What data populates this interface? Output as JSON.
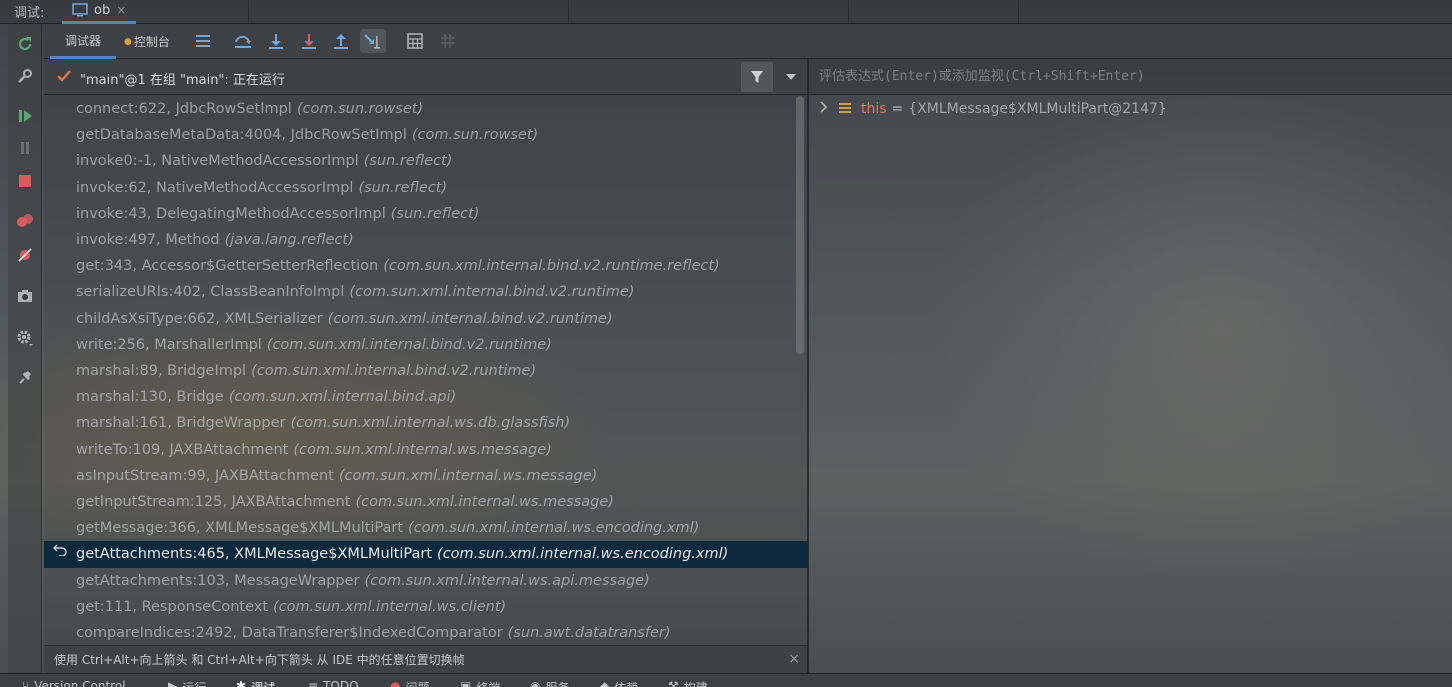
{
  "topbar": {
    "label": "调试:",
    "run_tab": {
      "name": "ob",
      "close": "×"
    }
  },
  "left_toolbar": {
    "icons": [
      "rerun-icon",
      "wrench-icon",
      "resume-icon",
      "pause-icon",
      "stop-icon",
      "breakpoints-icon",
      "mute-breakpoints-icon",
      "camera-icon",
      "settings-icon",
      "pin-icon"
    ]
  },
  "toolbar": {
    "tabs": [
      {
        "label": "调试器",
        "active": true
      },
      {
        "label": "控制台",
        "active": false
      }
    ],
    "buttons": [
      "frames-list-icon",
      "step-over-icon",
      "step-into-icon",
      "force-step-into-icon",
      "step-out-icon",
      "run-to-cursor-icon",
      "evaluate-expression-icon",
      "trace-icon"
    ]
  },
  "frames_panel": {
    "thread_label": "\"main\"@1 在组 \"main\": 正在运行",
    "frames": [
      {
        "method": "connect:622, JdbcRowSetImpl",
        "pkg": "(com.sun.rowset)"
      },
      {
        "method": "getDatabaseMetaData:4004, JdbcRowSetImpl",
        "pkg": "(com.sun.rowset)"
      },
      {
        "method": "invoke0:-1, NativeMethodAccessorImpl",
        "pkg": "(sun.reflect)"
      },
      {
        "method": "invoke:62, NativeMethodAccessorImpl",
        "pkg": "(sun.reflect)"
      },
      {
        "method": "invoke:43, DelegatingMethodAccessorImpl",
        "pkg": "(sun.reflect)"
      },
      {
        "method": "invoke:497, Method",
        "pkg": "(java.lang.reflect)"
      },
      {
        "method": "get:343, Accessor$GetterSetterReflection",
        "pkg": "(com.sun.xml.internal.bind.v2.runtime.reflect)"
      },
      {
        "method": "serializeURIs:402, ClassBeanInfoImpl",
        "pkg": "(com.sun.xml.internal.bind.v2.runtime)"
      },
      {
        "method": "childAsXsiType:662, XMLSerializer",
        "pkg": "(com.sun.xml.internal.bind.v2.runtime)"
      },
      {
        "method": "write:256, MarshallerImpl",
        "pkg": "(com.sun.xml.internal.bind.v2.runtime)"
      },
      {
        "method": "marshal:89, BridgeImpl",
        "pkg": "(com.sun.xml.internal.bind.v2.runtime)"
      },
      {
        "method": "marshal:130, Bridge",
        "pkg": "(com.sun.xml.internal.bind.api)"
      },
      {
        "method": "marshal:161, BridgeWrapper",
        "pkg": "(com.sun.xml.internal.ws.db.glassfish)"
      },
      {
        "method": "writeTo:109, JAXBAttachment",
        "pkg": "(com.sun.xml.internal.ws.message)"
      },
      {
        "method": "asInputStream:99, JAXBAttachment",
        "pkg": "(com.sun.xml.internal.ws.message)"
      },
      {
        "method": "getInputStream:125, JAXBAttachment",
        "pkg": "(com.sun.xml.internal.ws.message)"
      },
      {
        "method": "getMessage:366, XMLMessage$XMLMultiPart",
        "pkg": "(com.sun.xml.internal.ws.encoding.xml)"
      },
      {
        "method": "getAttachments:465, XMLMessage$XMLMultiPart",
        "pkg": "(com.sun.xml.internal.ws.encoding.xml)",
        "current": true
      },
      {
        "method": "getAttachments:103, MessageWrapper",
        "pkg": "(com.sun.xml.internal.ws.api.message)"
      },
      {
        "method": "get:111, ResponseContext",
        "pkg": "(com.sun.xml.internal.ws.client)"
      },
      {
        "method": "compareIndices:2492, DataTransferer$IndexedComparator",
        "pkg": "(sun.awt.datatransfer)"
      }
    ],
    "hint": "使用 Ctrl+Alt+向上箭头 和 Ctrl+Alt+向下箭头 从 IDE 中的任意位置切换帧",
    "hint_close": "×"
  },
  "variables_panel": {
    "eval_placeholder": "评估表达式(Enter)或添加监视(Ctrl+Shift+Enter)",
    "variables": [
      {
        "name": "this",
        "value": "{XMLMessage$XMLMultiPart@2147}"
      }
    ]
  },
  "bottom_bar": {
    "items": [
      {
        "label": "Version Control"
      },
      {
        "label": "运行"
      },
      {
        "label": "调试",
        "active": true
      },
      {
        "label": "TODO"
      },
      {
        "label": "问题"
      },
      {
        "label": "终端"
      },
      {
        "label": "服务"
      },
      {
        "label": "依赖"
      },
      {
        "label": "构建"
      }
    ]
  },
  "colors": {
    "accent": "#4a88c7",
    "selection": "#0d293e",
    "var_name": "#e6735a",
    "check": "#e0744b"
  }
}
